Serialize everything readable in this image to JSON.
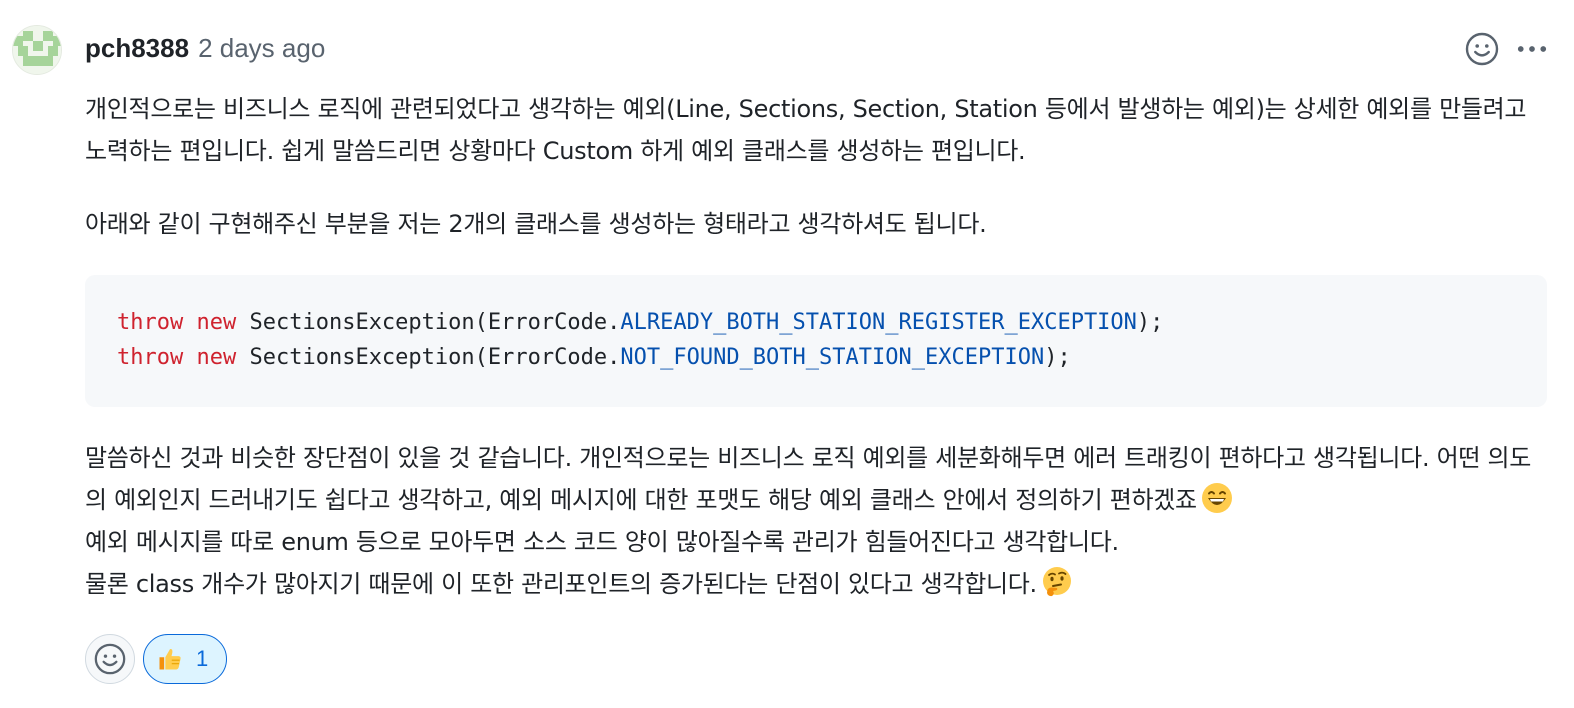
{
  "comment": {
    "author": "pch8388",
    "timestamp": "2 days ago",
    "paragraph1": "개인적으로는 비즈니스 로직에 관련되었다고 생각하는 예외(Line, Sections, Section, Station 등에서 발생하는 예외)는 상세한 예외를 만들려고 노력하는 편입니다. 쉽게 말씀드리면 상황마다 Custom 하게 예외 클래스를 생성하는 편입니다.",
    "paragraph2": "아래와 같이 구현해주신 부분을 저는 2개의 클래스를 생성하는 형태라고 생각하셔도 됩니다.",
    "code": {
      "line1": {
        "kw1": "throw",
        "kw2": "new",
        "call": "SectionsException(ErrorCode.",
        "const": "ALREADY_BOTH_STATION_REGISTER_EXCEPTION",
        "end": ");"
      },
      "line2": {
        "kw1": "throw",
        "kw2": "new",
        "call": "SectionsException(ErrorCode.",
        "const": "NOT_FOUND_BOTH_STATION_EXCEPTION",
        "end": ");"
      }
    },
    "paragraph3_line1": "말씀하신 것과 비슷한 장단점이 있을 것 같습니다. 개인적으로는 비즈니스 로직 예외를 세분화해두면 에러 트래킹이 편하다고 생각됩니다. 어떤 의도의 예외인지 드러내기도 쉽다고 생각하고, 예외 메시지에 대한 포맷도 해당 예외 클래스 안에서 정의하기 편하겠죠",
    "paragraph3_line2": "예외 메시지를 따로 enum 등으로 모아두면 소스 코드 양이 많아질수록 관리가 힘들어진다고 생각합니다.",
    "paragraph3_line3": "물론 class 개수가 많아지기 때문에 이 또한 관리포인트의 증가된다는 단점이 있다고 생각합니다.",
    "emoji1": "grinning-face-emoji",
    "emoji2": "thinking-face-emoji"
  },
  "reactions": {
    "add_icon": "smiley-icon",
    "thumbs_up_count": "1"
  },
  "colors": {
    "keyword": "#cf222e",
    "constant": "#0550ae",
    "reaction_accent": "#0969da"
  }
}
